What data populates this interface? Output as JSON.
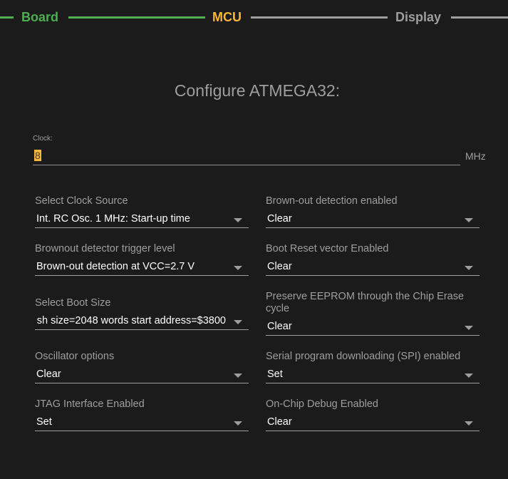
{
  "stepper": {
    "steps": [
      {
        "label": "Board",
        "state": "completed",
        "color": "#4caf50"
      },
      {
        "label": "MCU",
        "state": "active",
        "color": "#f9b737"
      },
      {
        "label": "Display",
        "state": "pending",
        "color": "#9e9e9e"
      }
    ]
  },
  "page": {
    "title": "Configure ATMEGA32:"
  },
  "clock": {
    "label": "Clock:",
    "value": "8",
    "unit": "MHz"
  },
  "fields": [
    {
      "label": "Select Clock Source",
      "value": "Int. RC Osc. 1 MHz: Start-up time"
    },
    {
      "label": "Brown-out detection enabled",
      "value": "Clear"
    },
    {
      "label": "Brownout detector trigger level",
      "value": "Brown-out detection at VCC=2.7 V"
    },
    {
      "label": "Boot Reset vector Enabled",
      "value": "Clear"
    },
    {
      "label": "Select Boot Size",
      "value": "sh size=2048 words start address=$3800"
    },
    {
      "label": "Preserve EEPROM through the Chip Erase cycle",
      "value": "Clear"
    },
    {
      "label": "Oscillator options",
      "value": "Clear"
    },
    {
      "label": "Serial program downloading (SPI) enabled",
      "value": "Set"
    },
    {
      "label": "JTAG Interface Enabled",
      "value": "Set"
    },
    {
      "label": "On-Chip Debug Enabled",
      "value": "Clear"
    }
  ]
}
